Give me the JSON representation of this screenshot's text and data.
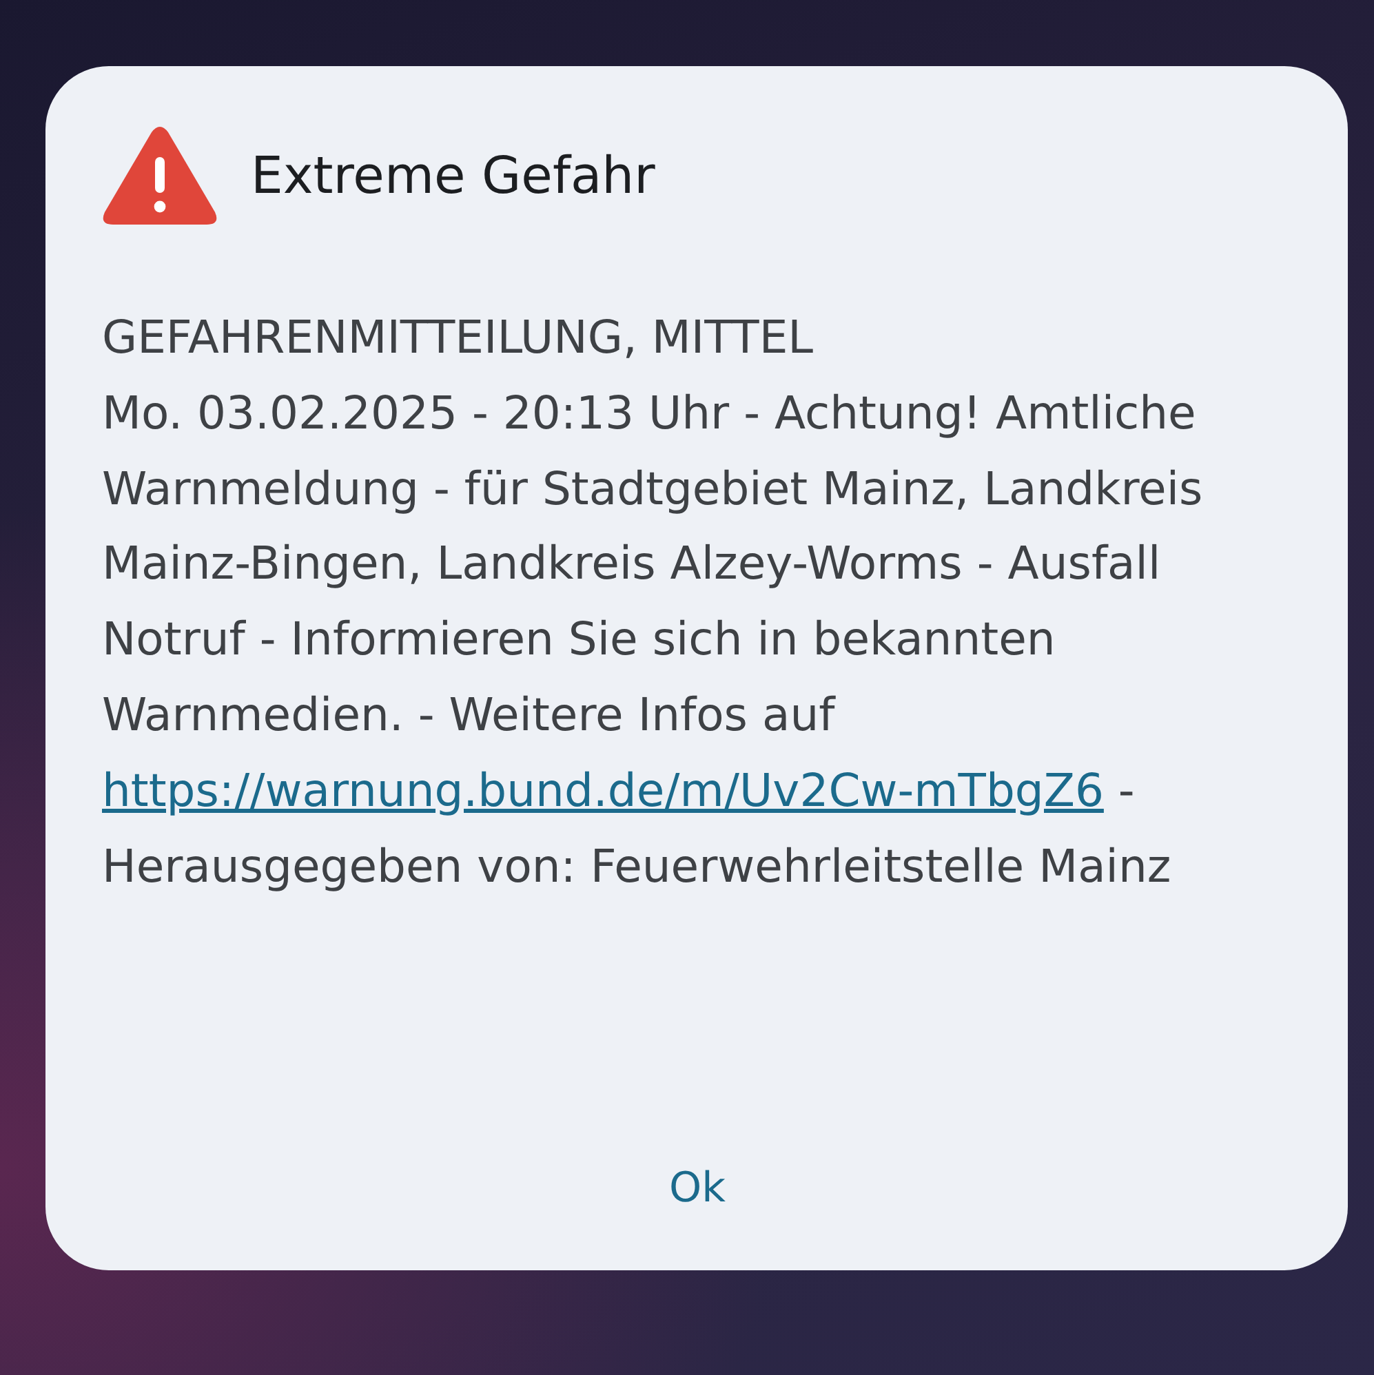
{
  "dialog": {
    "title": "Extreme Gefahr",
    "message_before": "GEFAHRENMITTEILUNG, MITTEL\nMo. 03.02.2025 - 20:13 Uhr - Achtung! Amtliche Warnmeldung - für Stadtgebiet Mainz, Landkreis Mainz-Bingen, Landkreis Alzey-Worms - Ausfall Notruf - Informieren Sie sich in bekannten Warnmedien. - Weitere Infos auf ",
    "link": "https://warnung.bund.de/m/Uv2Cw-mTbgZ6",
    "message_after": " - Herausgegeben von: Feuerwehrleitstelle Mainz",
    "buttons": [
      "Ok"
    ]
  }
}
